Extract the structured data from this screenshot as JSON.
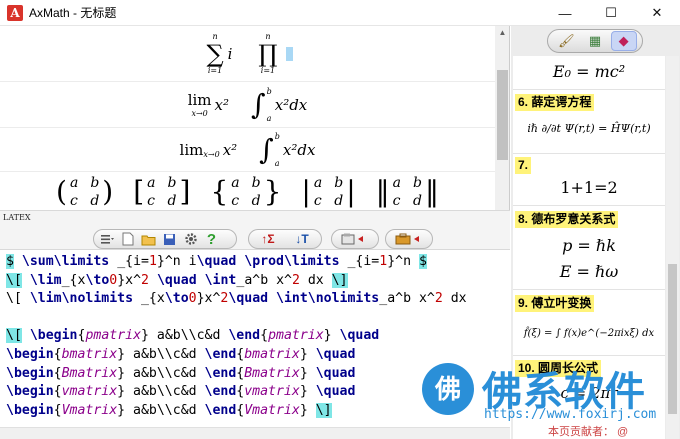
{
  "window": {
    "title": "AxMath - 无标题",
    "app_icon_letter": "A",
    "minimize": "—",
    "maximize": "☐",
    "close": "✕"
  },
  "preview": {
    "row1": {
      "sum_top": "n",
      "sum_sym": "∑",
      "sum_bot": "i=1",
      "sum_arg": "i",
      "prod_top": "n",
      "prod_sym": "∏",
      "prod_bot": "i=1"
    },
    "row2": {
      "lim": "lim",
      "lim_sub": "x→0",
      "lim_arg": "x²",
      "int_sym": "∫",
      "int_top": "b",
      "int_bot": "a",
      "int_arg": "x²dx"
    },
    "row3": {
      "lim": "lim",
      "lim_sub": "x→0",
      "lim_arg": "x²",
      "int_sym": "∫",
      "int_top": "b",
      "int_bot": "a",
      "int_arg": "x²dx"
    },
    "matrix_cells": [
      "a",
      "b",
      "c",
      "d"
    ],
    "brackets": [
      {
        "open": "(",
        "close": ")"
      },
      {
        "open": "[",
        "close": "]"
      },
      {
        "open": "{",
        "close": "}"
      },
      {
        "open": "|",
        "close": "|"
      },
      {
        "open": "‖",
        "close": "‖"
      }
    ]
  },
  "toolbar": {
    "latex_tag": "LATEX",
    "icons": [
      "dropdown-icon",
      "new-file-icon",
      "open-folder-icon",
      "save-icon",
      "settings-icon",
      "help-icon",
      "convert-to-latex-icon",
      "convert-to-text-icon",
      "clipboard-icon",
      "toolbox-icon"
    ]
  },
  "editor": {
    "lines": [
      {
        "segments": [
          [
            "dol",
            "$"
          ],
          [
            "",
            " "
          ],
          [
            "kw",
            "\\sum\\limits"
          ],
          [
            "",
            " _{i="
          ],
          [
            "num",
            "1"
          ],
          [
            "",
            "}^n i"
          ],
          [
            "kw",
            "\\quad"
          ],
          [
            "",
            " "
          ],
          [
            "kw",
            "\\prod\\limits"
          ],
          [
            "",
            " _{i="
          ],
          [
            "num",
            "1"
          ],
          [
            "",
            "}^n "
          ],
          [
            "dol",
            "$"
          ]
        ]
      },
      {
        "segments": [
          [
            "hl",
            "\\["
          ],
          [
            "",
            " "
          ],
          [
            "kw",
            "\\lim"
          ],
          [
            "",
            "_{x"
          ],
          [
            "kw",
            "\\to"
          ],
          [
            "num",
            "0"
          ],
          [
            "",
            "}x^"
          ],
          [
            "num",
            "2"
          ],
          [
            "",
            " "
          ],
          [
            "kw",
            "\\quad"
          ],
          [
            "",
            " "
          ],
          [
            "kw",
            "\\int"
          ],
          [
            "",
            "_a^b x^"
          ],
          [
            "num",
            "2"
          ],
          [
            "",
            " dx "
          ],
          [
            "hl",
            "\\]"
          ]
        ]
      },
      {
        "segments": [
          [
            "",
            "\\[ "
          ],
          [
            "kw",
            "\\lim\\nolimits"
          ],
          [
            "",
            " _{x"
          ],
          [
            "kw",
            "\\to"
          ],
          [
            "num",
            "0"
          ],
          [
            "",
            "}x^"
          ],
          [
            "num",
            "2"
          ],
          [
            "kw",
            "\\quad"
          ],
          [
            "",
            " "
          ],
          [
            "kw",
            "\\int\\nolimits"
          ],
          [
            "",
            "_a^b x^"
          ],
          [
            "num",
            "2"
          ],
          [
            "",
            " dx"
          ]
        ]
      },
      {
        "segments": []
      },
      {
        "segments": [
          [
            "hl",
            "\\["
          ],
          [
            "",
            " "
          ],
          [
            "kw",
            "\\begin"
          ],
          [
            "",
            "{"
          ],
          [
            "env",
            "pmatrix"
          ],
          [
            "",
            "} a&b\\\\c&d "
          ],
          [
            "kw",
            "\\end"
          ],
          [
            "",
            "{"
          ],
          [
            "env",
            "pmatrix"
          ],
          [
            "",
            "} "
          ],
          [
            "kw",
            "\\quad"
          ]
        ]
      },
      {
        "segments": [
          [
            "kw",
            "\\begin"
          ],
          [
            "",
            "{"
          ],
          [
            "env",
            "bmatrix"
          ],
          [
            "",
            "} a&b\\\\c&d "
          ],
          [
            "kw",
            "\\end"
          ],
          [
            "",
            "{"
          ],
          [
            "env",
            "bmatrix"
          ],
          [
            "",
            "} "
          ],
          [
            "kw",
            "\\quad"
          ]
        ]
      },
      {
        "segments": [
          [
            "kw",
            "\\begin"
          ],
          [
            "",
            "{"
          ],
          [
            "env",
            "Bmatrix"
          ],
          [
            "",
            "} a&b\\\\c&d "
          ],
          [
            "kw",
            "\\end"
          ],
          [
            "",
            "{"
          ],
          [
            "env",
            "Bmatrix"
          ],
          [
            "",
            "} "
          ],
          [
            "kw",
            "\\quad"
          ]
        ]
      },
      {
        "segments": [
          [
            "kw",
            "\\begin"
          ],
          [
            "",
            "{"
          ],
          [
            "env",
            "vmatrix"
          ],
          [
            "",
            "} a&b\\\\c&d "
          ],
          [
            "kw",
            "\\end"
          ],
          [
            "",
            "{"
          ],
          [
            "env",
            "vmatrix"
          ],
          [
            "",
            "} "
          ],
          [
            "kw",
            "\\quad"
          ]
        ]
      },
      {
        "segments": [
          [
            "kw",
            "\\begin"
          ],
          [
            "",
            "{"
          ],
          [
            "env",
            "Vmatrix"
          ],
          [
            "",
            "} a&b\\\\c&d "
          ],
          [
            "kw",
            "\\end"
          ],
          [
            "",
            "{"
          ],
          [
            "env",
            "Vmatrix"
          ],
          [
            "",
            "} "
          ],
          [
            "hl",
            "\\]"
          ]
        ]
      }
    ]
  },
  "right_panel": {
    "tabs": [
      {
        "icon": "brush-icon",
        "glyph": "🖌",
        "active": false
      },
      {
        "icon": "grid-icon",
        "glyph": "▦",
        "active": false
      },
      {
        "icon": "bookmark-icon",
        "glyph": "◆",
        "active": true
      }
    ],
    "items": [
      {
        "label": "",
        "formula": "E₀ = mc²"
      },
      {
        "label": "6. 薛定谔方程",
        "formula": "iℏ ∂/∂t Ψ(r,t) = ĤΨ(r,t)"
      },
      {
        "label": "7.",
        "formula": "1+1=2"
      },
      {
        "label": "8. 德布罗意关系式",
        "formula": "p = ℏk",
        "formula2": "E = ℏω"
      },
      {
        "label": "9. 傅立叶变换",
        "formula": "f̂(ξ) = ∫ f(x)e^(−2πixξ) dx"
      },
      {
        "label": "10. 圆周长公式",
        "formula": "c = 2πr"
      }
    ]
  },
  "watermark": {
    "logo": "佛",
    "text": "佛系软件",
    "url": "https://www.foxirj.com",
    "author": "本页贡献者：  @"
  }
}
